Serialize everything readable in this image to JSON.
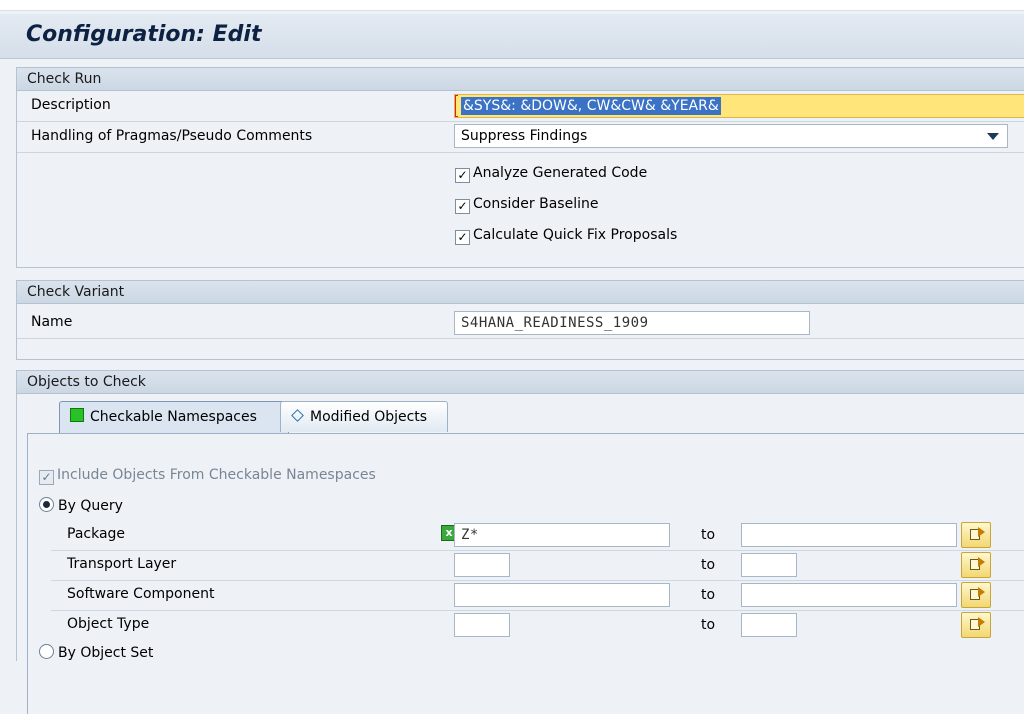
{
  "title": "Configuration: Edit",
  "check_run": {
    "header": "Check Run",
    "description_label": "Description",
    "description_value": "&SYS&: &DOW&, CW&CW& &YEAR&",
    "pragmas_label": "Handling of Pragmas/Pseudo Comments",
    "pragmas_value": "Suppress Findings",
    "checkboxes": [
      {
        "label": "Analyze Generated Code",
        "checked": true
      },
      {
        "label": "Consider Baseline",
        "checked": true
      },
      {
        "label": "Calculate Quick Fix Proposals",
        "checked": true
      }
    ]
  },
  "check_variant": {
    "header": "Check Variant",
    "name_label": "Name",
    "name_value": "S4HANA_READINESS_1909"
  },
  "objects": {
    "header": "Objects to Check",
    "tabs": [
      {
        "label": "Checkable Namespaces",
        "active": true
      },
      {
        "label": "Modified Objects",
        "active": false
      }
    ],
    "include_label": "Include Objects From Checkable Namespaces",
    "by_query_label": "By Query",
    "to_label": "to",
    "rows": [
      {
        "label": "Package",
        "from": "Z*",
        "to": ""
      },
      {
        "label": "Transport Layer",
        "from": "",
        "to": ""
      },
      {
        "label": "Software Component",
        "from": "",
        "to": ""
      },
      {
        "label": "Object Type",
        "from": "",
        "to": ""
      }
    ],
    "by_object_set_label": "By Object Set"
  },
  "icons": {
    "checkmark": "✓",
    "exclude": "x"
  }
}
